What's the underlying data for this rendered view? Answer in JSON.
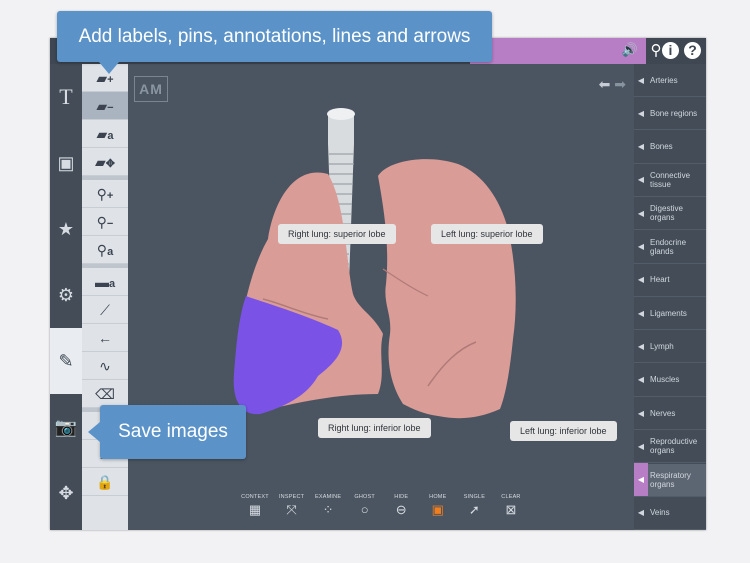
{
  "callouts": {
    "top": "Add labels, pins, annotations, lines and arrows",
    "save": "Save images"
  },
  "topbar": {
    "icons": [
      "speaker-icon",
      "search-icon",
      "info-icon",
      "help-icon"
    ]
  },
  "left_toolbar": {
    "items": [
      {
        "icon": "text-icon",
        "glyph": "T"
      },
      {
        "icon": "frame-icon",
        "glyph": "▣"
      },
      {
        "icon": "star-icon",
        "glyph": "★"
      },
      {
        "icon": "gear-icon",
        "glyph": "⚙"
      },
      {
        "icon": "pen-tools-icon",
        "glyph": "✎"
      },
      {
        "icon": "camera-icon",
        "glyph": "📷"
      },
      {
        "icon": "move-icon",
        "glyph": "✥"
      }
    ],
    "active_index": 4
  },
  "palette": {
    "items": [
      {
        "icon": "add-label-icon",
        "glyph": "▰",
        "sub": "+"
      },
      {
        "icon": "remove-label-icon",
        "glyph": "▰",
        "sub": "−"
      },
      {
        "icon": "edit-label-icon",
        "glyph": "▰",
        "sub": "a"
      },
      {
        "icon": "move-label-icon",
        "glyph": "▰",
        "sub": "✥"
      },
      {
        "icon": "add-pin-icon",
        "glyph": "⚲",
        "sub": "+"
      },
      {
        "icon": "remove-pin-icon",
        "glyph": "⚲",
        "sub": "−"
      },
      {
        "icon": "edit-pin-icon",
        "glyph": "⚲",
        "sub": "a"
      },
      {
        "icon": "annotation-icon",
        "glyph": "▬",
        "sub": "a"
      },
      {
        "icon": "line-icon",
        "glyph": "⟋",
        "sub": ""
      },
      {
        "icon": "arrow-icon",
        "glyph": "←",
        "sub": ""
      },
      {
        "icon": "freehand-icon",
        "glyph": "∿",
        "sub": ""
      },
      {
        "icon": "eraser-icon",
        "glyph": "⌫",
        "sub": ""
      },
      {
        "icon": "list-icon",
        "glyph": "≡",
        "sub": ""
      },
      {
        "icon": "clear-eraser-icon",
        "glyph": "≣",
        "sub": ""
      },
      {
        "icon": "lock-icon",
        "glyph": "🔒",
        "sub": ""
      }
    ],
    "selected_index": 1
  },
  "viewport": {
    "logo": "AM",
    "labels": {
      "right_superior": "Right lung: superior lobe",
      "left_superior": "Left lung: superior lobe",
      "right_inferior": "Right lung: inferior lobe",
      "left_inferior": "Left lung: inferior lobe"
    }
  },
  "bottombar": {
    "items": [
      {
        "label": "CONTEXT",
        "icon": "context-icon",
        "glyph": "▦"
      },
      {
        "label": "INSPECT",
        "icon": "inspect-icon",
        "glyph": "⤧"
      },
      {
        "label": "EXAMINE",
        "icon": "examine-icon",
        "glyph": "⁘"
      },
      {
        "label": "GHOST",
        "icon": "ghost-icon",
        "glyph": "○"
      },
      {
        "label": "HIDE",
        "icon": "hide-icon",
        "glyph": "⊖"
      },
      {
        "label": "HOME",
        "icon": "home-icon",
        "glyph": "▣"
      },
      {
        "label": "SINGLE",
        "icon": "single-icon",
        "glyph": "➚"
      },
      {
        "label": "CLEAR",
        "icon": "clear-icon",
        "glyph": "⊠"
      }
    ]
  },
  "categories": {
    "items": [
      "Arteries",
      "Bone regions",
      "Bones",
      "Connective tissue",
      "Digestive organs",
      "Endocrine glands",
      "Heart",
      "Ligaments",
      "Lymph",
      "Muscles",
      "Nerves",
      "Reproductive organs",
      "Respiratory organs",
      "Veins"
    ],
    "active_index": 12
  },
  "colors": {
    "accent_purple": "#b77ec6",
    "callout_blue": "#5b93c9",
    "lung_pink": "#d99c97",
    "highlight_violet": "#7a53e6",
    "home_orange": "#f07d1e"
  }
}
